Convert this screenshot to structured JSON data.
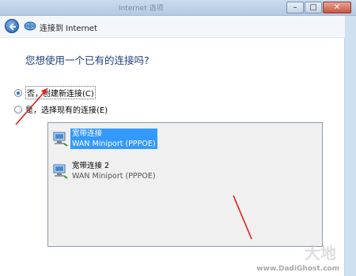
{
  "background_window": {
    "title": "Internet 选项"
  },
  "dialog": {
    "title": "连接到 Internet",
    "question": "您想使用一个已有的连接吗?",
    "options": [
      {
        "label": "否，创建新连接(C)",
        "checked": true
      },
      {
        "label": "是，选择现有的连接(E)",
        "checked": false
      }
    ],
    "connections": [
      {
        "name": "宽带连接",
        "type": "WAN Miniport (PPPOE)",
        "selected": true
      },
      {
        "name": "宽带连接 2",
        "type": "WAN Miniport (PPPOE)",
        "selected": false
      }
    ]
  },
  "watermark": {
    "brand": "大地",
    "site": "www.DadiGhost.com"
  },
  "colors": {
    "selection": "#3399ff",
    "annotation_arrow": "#e02020",
    "question_text": "#1e3f7a"
  }
}
